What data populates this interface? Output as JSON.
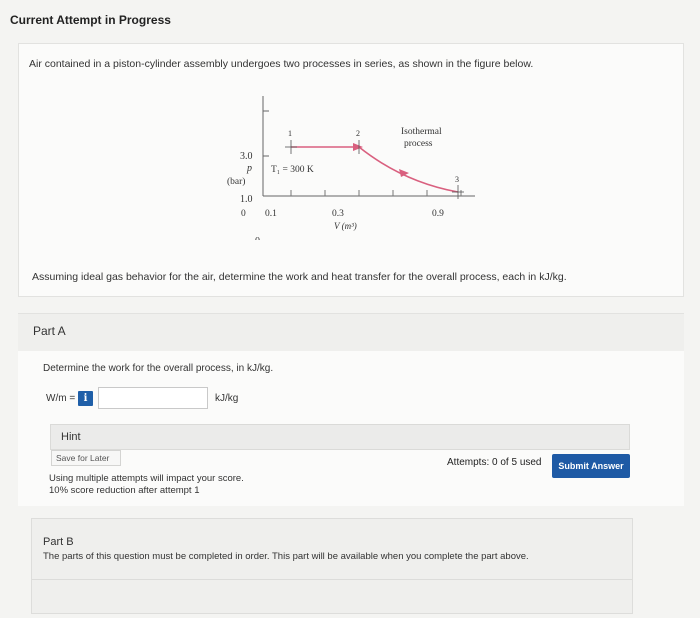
{
  "page": {
    "title": "Current Attempt in Progress"
  },
  "problem": {
    "statement": "Air contained in a piston-cylinder assembly undergoes two processes in series, as shown in the figure below.",
    "question": "Assuming ideal gas behavior for the air, determine the work and heat transfer for the overall process, each in kJ/kg."
  },
  "diagram": {
    "y_axis_symbol": "p",
    "y_axis_unit": "(bar)",
    "y_tick_high": "3.0",
    "y_tick_low": "1.0",
    "origin": "0",
    "x_tick_1": "0",
    "x_tick_2": "0.1",
    "x_tick_3": "0.3",
    "x_tick_4": "0.9",
    "x_axis_label": "V (m³)",
    "temperature_label": "T₁ = 300 K",
    "state_1": "1",
    "state_2": "2",
    "state_3": "3",
    "process_label_line1": "Isothermal",
    "process_label_line2": "process",
    "points": {
      "state1": {
        "V_m3": 0.1,
        "p_bar": 3.0
      },
      "state2": {
        "V_m3": 0.3,
        "p_bar": 3.0
      },
      "state3": {
        "V_m3": 0.9,
        "p_bar": 1.0
      }
    }
  },
  "part_a": {
    "label": "Part A",
    "prompt": "Determine the work for the overall process, in kJ/kg.",
    "input_label": "W/m =",
    "info_icon": "i",
    "input_value": "",
    "unit": "kJ/kg",
    "hint": "Hint",
    "save_later": "Save for Later",
    "attempts_note_1": "Using multiple attempts will impact your score.",
    "attempts_note_2": "10% score reduction after attempt 1",
    "attempts_used": "Attempts: 0 of 5 used",
    "submit": "Submit Answer"
  },
  "part_b": {
    "label": "Part B",
    "text": "The parts of this question must be completed in order. This part will be available when you complete the part above."
  }
}
